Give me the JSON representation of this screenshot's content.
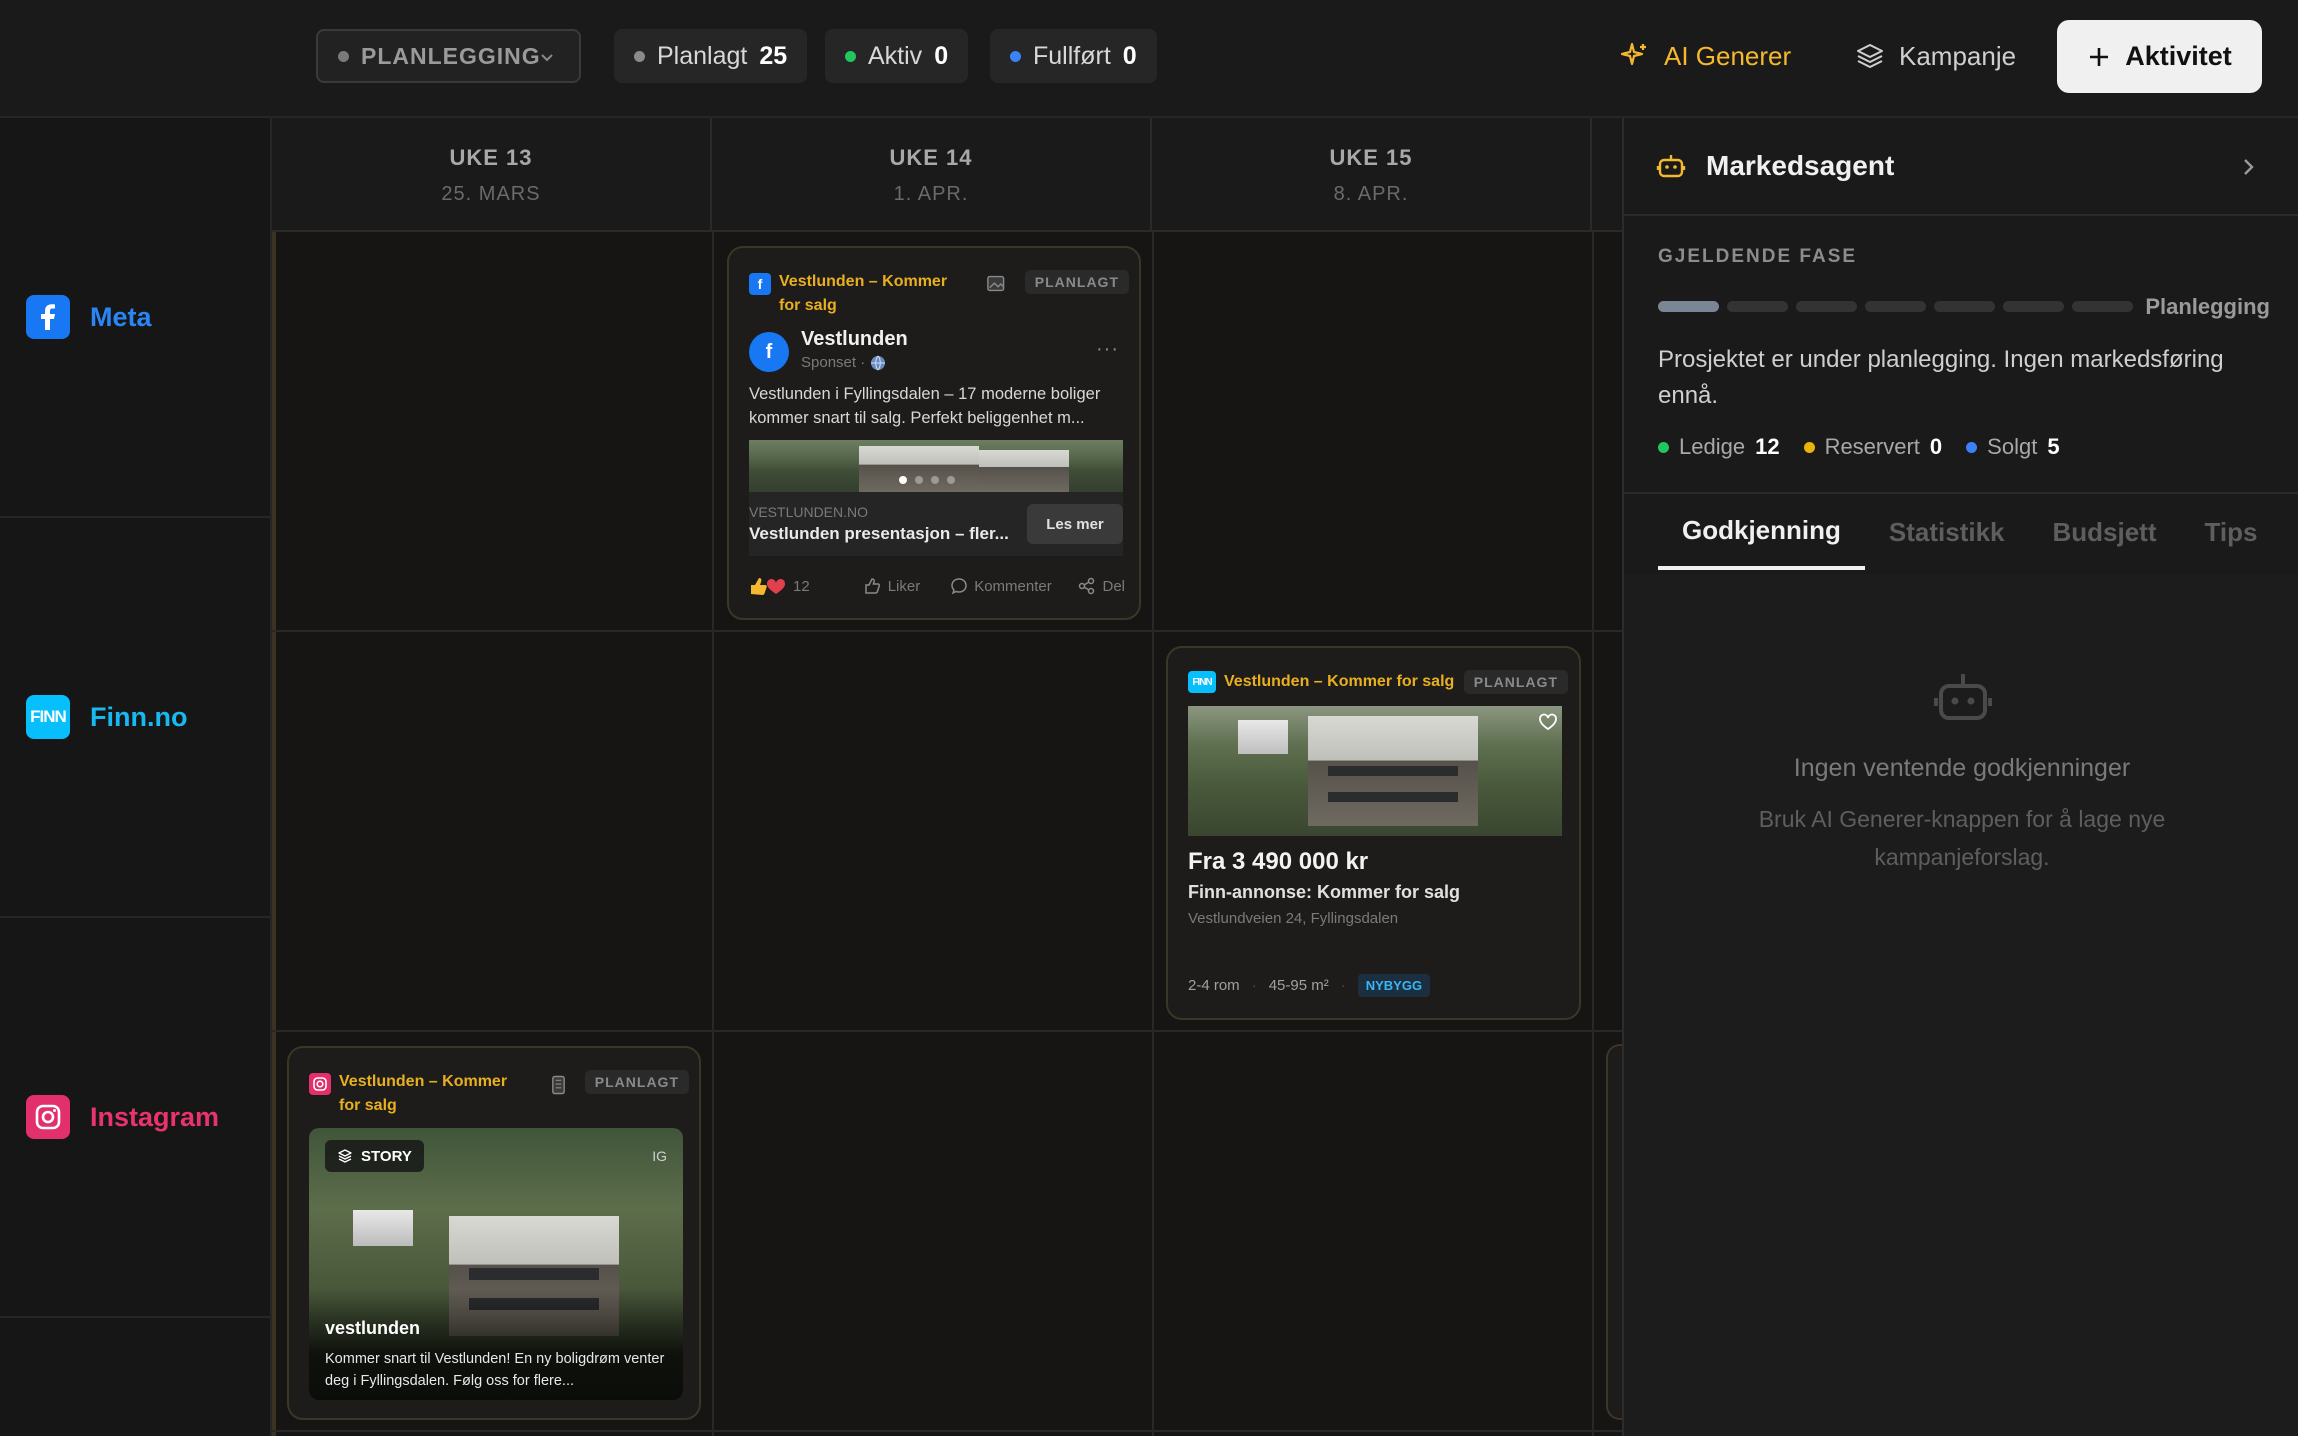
{
  "toolbar": {
    "phase_select": "PLANLEGGING",
    "stats": [
      {
        "label": "Planlagt",
        "count": "25",
        "color": "#8a8a8a"
      },
      {
        "label": "Aktiv",
        "count": "0",
        "color": "#22c55e"
      },
      {
        "label": "Fullført",
        "count": "0",
        "color": "#3b82f6"
      }
    ],
    "ai_generate": "AI Generer",
    "campaign": "Kampanje",
    "add_activity": "Aktivitet",
    "accent_color": "#f5b82e"
  },
  "channels": [
    {
      "name": "Meta",
      "color": "#1877f2"
    },
    {
      "name": "Finn.no",
      "color": "#06bffc",
      "icon_text": "FINN"
    },
    {
      "name": "Instagram",
      "color": "#e1306c"
    }
  ],
  "weeks": [
    {
      "week": "UKE 13",
      "date": "25. MARS"
    },
    {
      "week": "UKE 14",
      "date": "1. APR."
    },
    {
      "week": "UKE 15",
      "date": "8. APR."
    }
  ],
  "meta_card": {
    "title": "Vestlunden – Kommer for salg",
    "status": "PLANLAGT",
    "page_name": "Vestlunden",
    "sponsored": "Sponset ·",
    "body": "Vestlunden i Fyllingsdalen – 17 moderne boliger kommer snart til salg. Perfekt beliggenhet m...",
    "link_domain": "VESTLUNDEN.NO",
    "link_title": "Vestlunden presentasjon – fler...",
    "cta": "Les mer",
    "reactions": "12",
    "like": "Liker",
    "comment": "Kommenter",
    "share": "Del"
  },
  "finn_card": {
    "title": "Vestlunden – Kommer for salg",
    "status": "PLANLAGT",
    "icon_text": "FINN",
    "price": "Fra 3 490 000 kr",
    "ad_title": "Finn-annonse: Kommer for salg",
    "address": "Vestlundveien 24, Fyllingsdalen",
    "rooms": "2-4 rom",
    "size": "45-95 m²",
    "tag": "NYBYGG"
  },
  "ig_card": {
    "title": "Vestlunden – Kommer for salg",
    "status": "PLANLAGT",
    "story_label": "STORY",
    "ig_label": "IG",
    "account": "vestlunden",
    "caption": "Kommer snart til Vestlunden! En ny boligdrøm venter deg i Fyllingsdalen. Følg oss for flere..."
  },
  "panel": {
    "title": "Markedsagent",
    "phase_heading": "GJELDENDE FASE",
    "phase_name": "Planlegging",
    "phase_steps_total": 7,
    "phase_steps_done": 1,
    "description": "Prosjektet er under planlegging. Ingen markedsføring ennå.",
    "units": [
      {
        "label": "Ledige",
        "count": "12",
        "color": "#22c55e"
      },
      {
        "label": "Reservert",
        "count": "0",
        "color": "#eab308"
      },
      {
        "label": "Solgt",
        "count": "5",
        "color": "#3b82f6"
      }
    ],
    "tabs": [
      "Godkjenning",
      "Statistikk",
      "Budsjett",
      "Tips"
    ],
    "active_tab": "Godkjenning",
    "empty_title": "Ingen ventende godkjenninger",
    "empty_text": "Bruk AI Generer-knappen for å lage nye kampanjeforslag."
  }
}
